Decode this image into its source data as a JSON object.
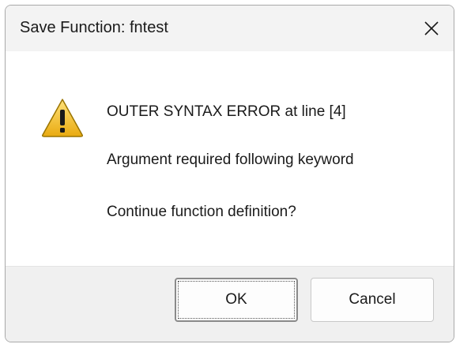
{
  "window": {
    "title": "Save Function: fntest",
    "close_icon": "close-x-icon"
  },
  "message": {
    "icon": "warning-triangle-icon",
    "line1": "OUTER SYNTAX ERROR at line [4]",
    "line2": "Argument required following keyword",
    "line3": "Continue function definition?"
  },
  "buttons": {
    "ok_label": "OK",
    "cancel_label": "Cancel"
  },
  "colors": {
    "warning_fill": "#f2c12e",
    "warning_outline": "#8a6a00",
    "titlebar_bg": "#f3f3f3",
    "footer_bg": "#f0f0f0"
  }
}
